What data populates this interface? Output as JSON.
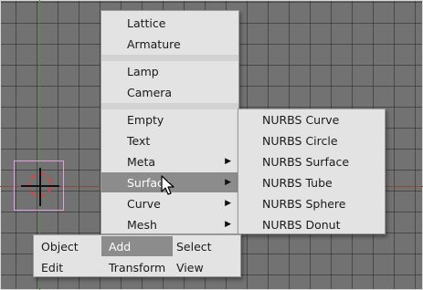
{
  "add_menu": {
    "items": [
      {
        "label": "Lattice"
      },
      {
        "label": "Armature"
      },
      {
        "label": "Lamp"
      },
      {
        "label": "Camera"
      },
      {
        "label": "Empty"
      },
      {
        "label": "Text"
      },
      {
        "label": "Meta"
      },
      {
        "label": "Surface"
      },
      {
        "label": "Curve"
      },
      {
        "label": "Mesh"
      }
    ]
  },
  "surface_menu": {
    "items": [
      {
        "label": "NURBS Curve"
      },
      {
        "label": "NURBS Circle"
      },
      {
        "label": "NURBS Surface"
      },
      {
        "label": "NURBS Tube"
      },
      {
        "label": "NURBS Sphere"
      },
      {
        "label": "NURBS Donut"
      }
    ]
  },
  "toolbar": {
    "object": "Object",
    "add": "Add",
    "select": "Select",
    "edit": "Edit",
    "transform": "Transform",
    "view": "View"
  },
  "colors": {
    "menu_bg": "#e3e3e3",
    "highlight": "#8c8c8c",
    "viewport_bg": "#727272"
  }
}
